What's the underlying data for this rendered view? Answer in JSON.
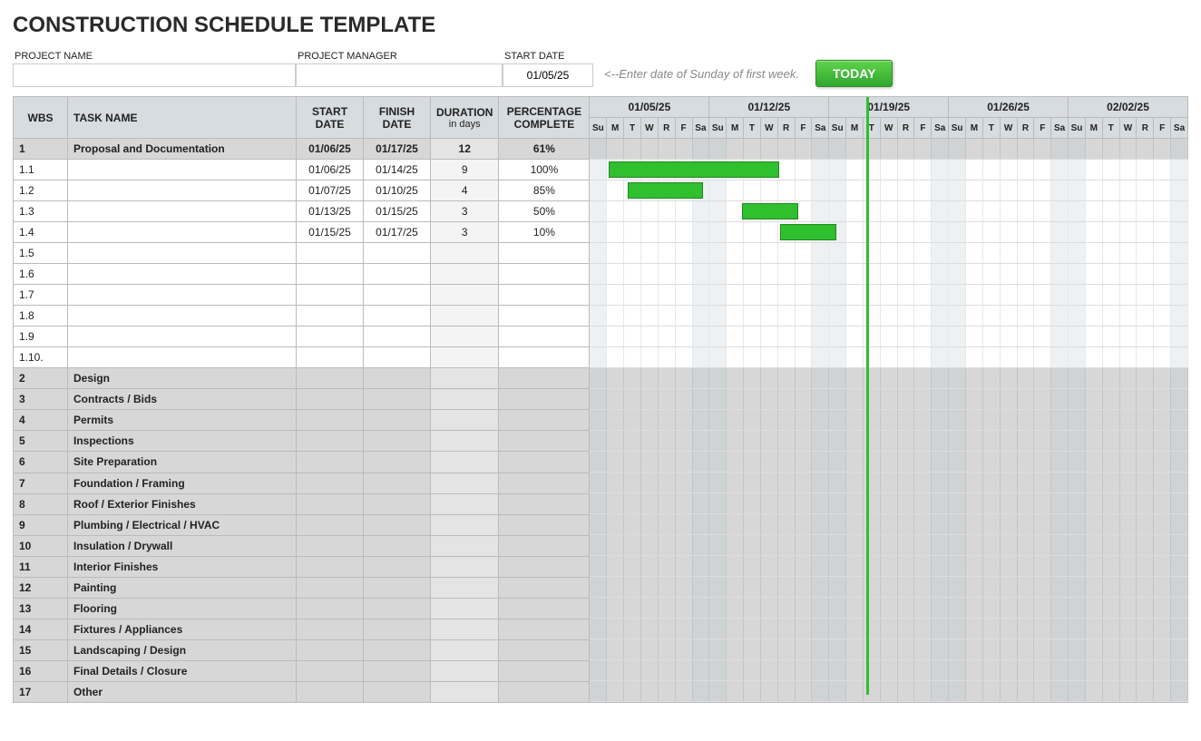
{
  "title": "CONSTRUCTION SCHEDULE TEMPLATE",
  "meta": {
    "project_name_label": "PROJECT NAME",
    "project_manager_label": "PROJECT MANAGER",
    "start_date_label": "START DATE",
    "project_name": "",
    "project_manager": "",
    "start_date": "01/05/25",
    "hint": "<--Enter date of Sunday of first week.",
    "today_label": "TODAY"
  },
  "headers": {
    "wbs": "WBS",
    "task": "TASK NAME",
    "start": "START DATE",
    "finish": "FINISH DATE",
    "duration": "DURATION",
    "duration_sub": "in days",
    "pct": "PERCENTAGE COMPLETE"
  },
  "weeks": [
    "01/05/25",
    "01/12/25",
    "01/19/25",
    "01/26/25",
    "02/02/25"
  ],
  "day_labels": [
    "Su",
    "M",
    "T",
    "W",
    "R",
    "F",
    "Sa"
  ],
  "today_day_index": 14,
  "rows": [
    {
      "type": "section",
      "wbs": "1",
      "task": "Proposal and Documentation",
      "start": "01/06/25",
      "finish": "01/17/25",
      "dur": "12",
      "pct": "61%"
    },
    {
      "type": "data",
      "wbs": "1.1",
      "task": "",
      "start": "01/06/25",
      "finish": "01/14/25",
      "dur": "9",
      "pct": "100%",
      "bar_start": 1,
      "bar_len": 9
    },
    {
      "type": "data",
      "wbs": "1.2",
      "task": "",
      "start": "01/07/25",
      "finish": "01/10/25",
      "dur": "4",
      "pct": "85%",
      "bar_start": 2,
      "bar_len": 4
    },
    {
      "type": "data",
      "wbs": "1.3",
      "task": "",
      "start": "01/13/25",
      "finish": "01/15/25",
      "dur": "3",
      "pct": "50%",
      "bar_start": 8,
      "bar_len": 3
    },
    {
      "type": "data",
      "wbs": "1.4",
      "task": "",
      "start": "01/15/25",
      "finish": "01/17/25",
      "dur": "3",
      "pct": "10%",
      "bar_start": 10,
      "bar_len": 3
    },
    {
      "type": "data",
      "wbs": "1.5",
      "task": "",
      "start": "",
      "finish": "",
      "dur": "",
      "pct": ""
    },
    {
      "type": "data",
      "wbs": "1.6",
      "task": "",
      "start": "",
      "finish": "",
      "dur": "",
      "pct": ""
    },
    {
      "type": "data",
      "wbs": "1.7",
      "task": "",
      "start": "",
      "finish": "",
      "dur": "",
      "pct": ""
    },
    {
      "type": "data",
      "wbs": "1.8",
      "task": "",
      "start": "",
      "finish": "",
      "dur": "",
      "pct": ""
    },
    {
      "type": "data",
      "wbs": "1.9",
      "task": "",
      "start": "",
      "finish": "",
      "dur": "",
      "pct": ""
    },
    {
      "type": "data",
      "wbs": "1.10.",
      "task": "",
      "start": "",
      "finish": "",
      "dur": "",
      "pct": ""
    },
    {
      "type": "section",
      "wbs": "2",
      "task": "Design",
      "start": "",
      "finish": "",
      "dur": "",
      "pct": ""
    },
    {
      "type": "section",
      "wbs": "3",
      "task": "Contracts / Bids",
      "start": "",
      "finish": "",
      "dur": "",
      "pct": ""
    },
    {
      "type": "section",
      "wbs": "4",
      "task": "Permits",
      "start": "",
      "finish": "",
      "dur": "",
      "pct": ""
    },
    {
      "type": "section",
      "wbs": "5",
      "task": "Inspections",
      "start": "",
      "finish": "",
      "dur": "",
      "pct": ""
    },
    {
      "type": "section",
      "wbs": "6",
      "task": "Site Preparation",
      "start": "",
      "finish": "",
      "dur": "",
      "pct": ""
    },
    {
      "type": "section",
      "wbs": "7",
      "task": "Foundation / Framing",
      "start": "",
      "finish": "",
      "dur": "",
      "pct": ""
    },
    {
      "type": "section",
      "wbs": "8",
      "task": "Roof / Exterior Finishes",
      "start": "",
      "finish": "",
      "dur": "",
      "pct": ""
    },
    {
      "type": "section",
      "wbs": "9",
      "task": "Plumbing / Electrical / HVAC",
      "start": "",
      "finish": "",
      "dur": "",
      "pct": ""
    },
    {
      "type": "section",
      "wbs": "10",
      "task": "Insulation / Drywall",
      "start": "",
      "finish": "",
      "dur": "",
      "pct": ""
    },
    {
      "type": "section",
      "wbs": "11",
      "task": "Interior Finishes",
      "start": "",
      "finish": "",
      "dur": "",
      "pct": ""
    },
    {
      "type": "section",
      "wbs": "12",
      "task": "Painting",
      "start": "",
      "finish": "",
      "dur": "",
      "pct": ""
    },
    {
      "type": "section",
      "wbs": "13",
      "task": "Flooring",
      "start": "",
      "finish": "",
      "dur": "",
      "pct": ""
    },
    {
      "type": "section",
      "wbs": "14",
      "task": "Fixtures / Appliances",
      "start": "",
      "finish": "",
      "dur": "",
      "pct": ""
    },
    {
      "type": "section",
      "wbs": "15",
      "task": "Landscaping / Design",
      "start": "",
      "finish": "",
      "dur": "",
      "pct": ""
    },
    {
      "type": "section",
      "wbs": "16",
      "task": "Final Details / Closure",
      "start": "",
      "finish": "",
      "dur": "",
      "pct": ""
    },
    {
      "type": "section",
      "wbs": "17",
      "task": "Other",
      "start": "",
      "finish": "",
      "dur": "",
      "pct": ""
    }
  ],
  "day_width": 21,
  "total_days": 35
}
